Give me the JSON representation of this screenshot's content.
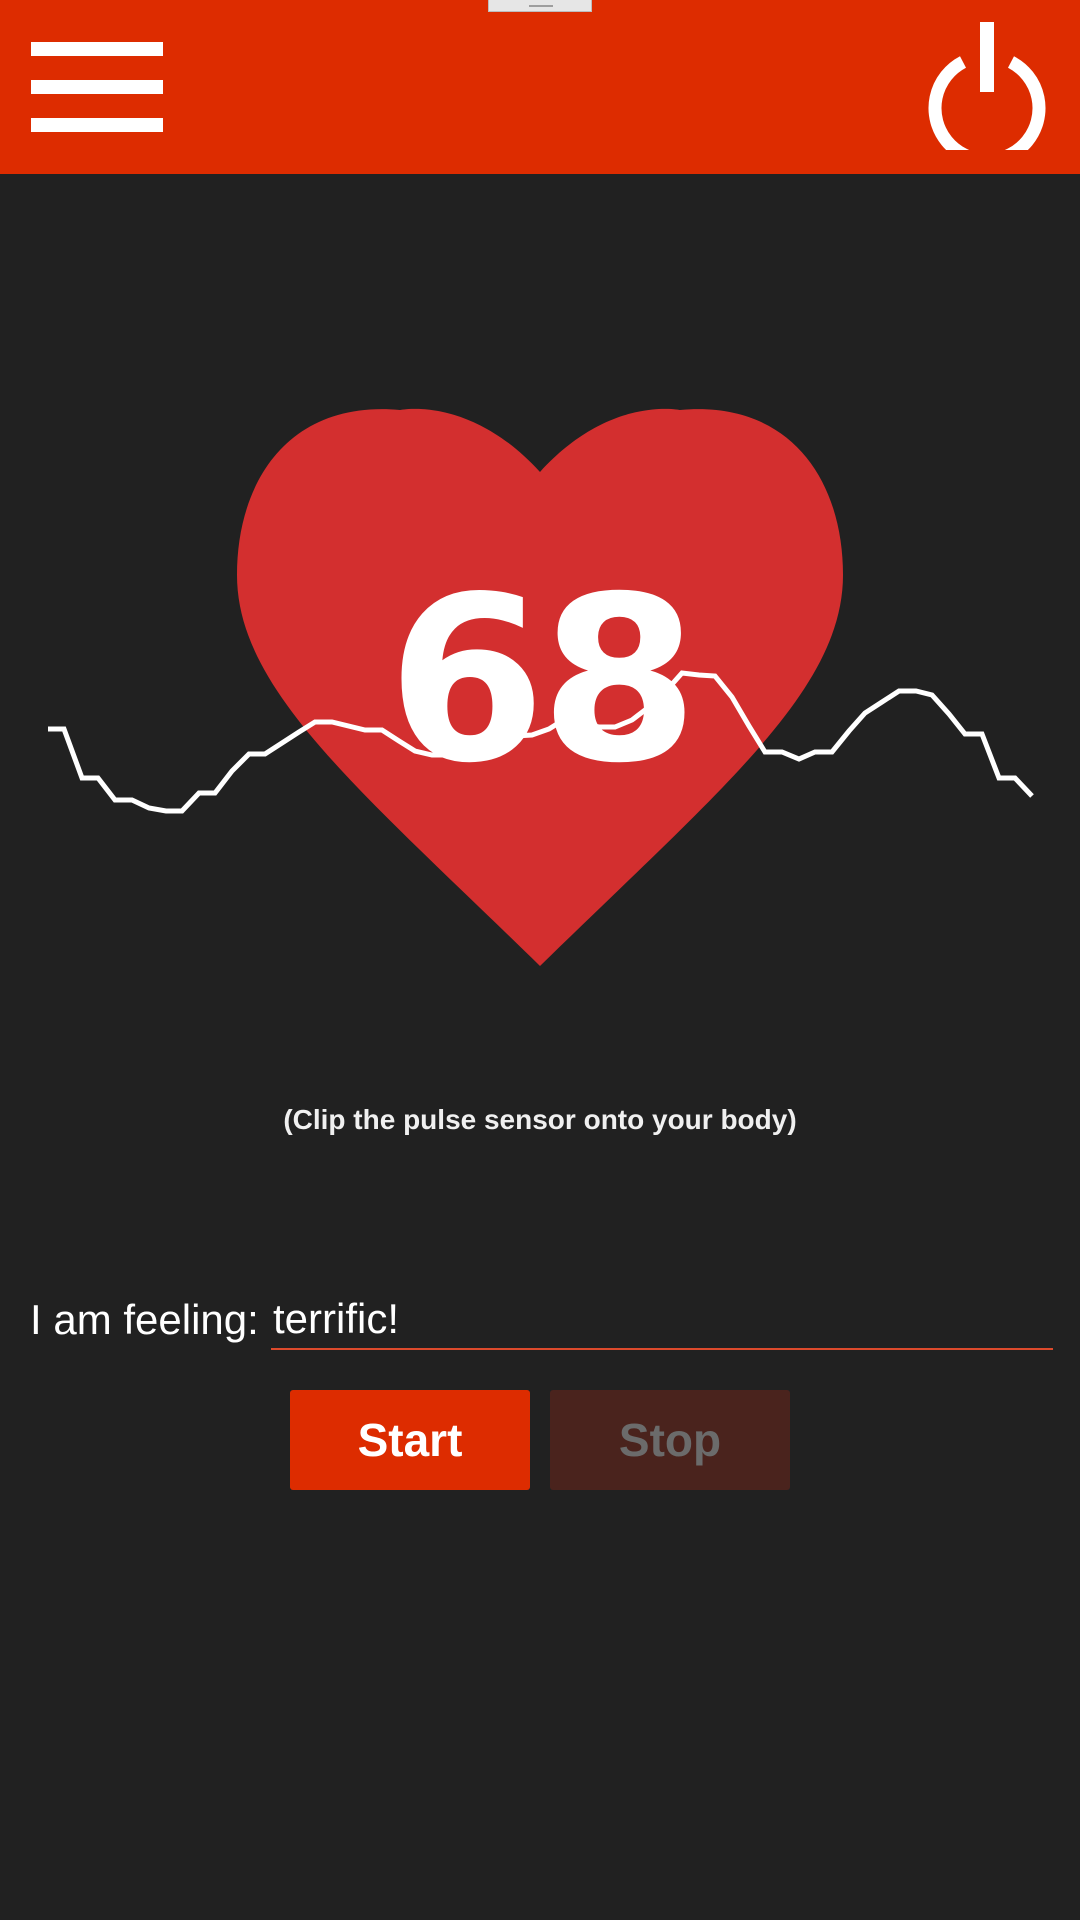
{
  "app_bar": {
    "color": "#dd2c00",
    "menu_icon": "hamburger-menu-icon",
    "power_icon": "power-icon"
  },
  "heart": {
    "color": "#d32f2f",
    "bpm": "68"
  },
  "pulse_trace": {
    "color": "#ffffff"
  },
  "hint_text": "(Clip the pulse sensor onto your body)",
  "feeling": {
    "label": "I am feeling:",
    "value": "terrific!"
  },
  "buttons": {
    "start_label": "Start",
    "stop_label": "Stop",
    "start_color": "#dd2c00",
    "stop_color": "#4a231d"
  }
}
